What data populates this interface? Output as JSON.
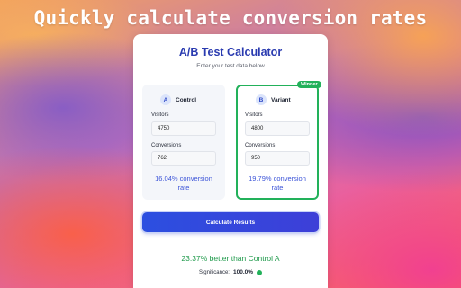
{
  "headline": "Quickly calculate conversion rates",
  "calculator": {
    "title": "A/B Test Calculator",
    "subtitle": "Enter your test data below",
    "control": {
      "letter": "A",
      "name": "Control",
      "visitors_label": "Visitors",
      "visitors_value": "4750",
      "conversions_label": "Conversions",
      "conversions_value": "762",
      "rate_line1": "16.04% conversion",
      "rate_line2": "rate"
    },
    "variant": {
      "letter": "B",
      "name": "Variant",
      "badge": "Winner",
      "visitors_label": "Visitors",
      "visitors_value": "4800",
      "conversions_label": "Conversions",
      "conversions_value": "950",
      "rate_line1": "19.79% conversion",
      "rate_line2": "rate"
    },
    "button_label": "Calculate Results",
    "result_text": "23.37% better than Control A",
    "significance_label": "Significance:",
    "significance_value": "100.0%"
  },
  "colors": {
    "accent": "#2c4fe0",
    "winner": "#22b15a",
    "title": "#2a3bb0"
  },
  "icons": [
    "status-dot-icon"
  ]
}
